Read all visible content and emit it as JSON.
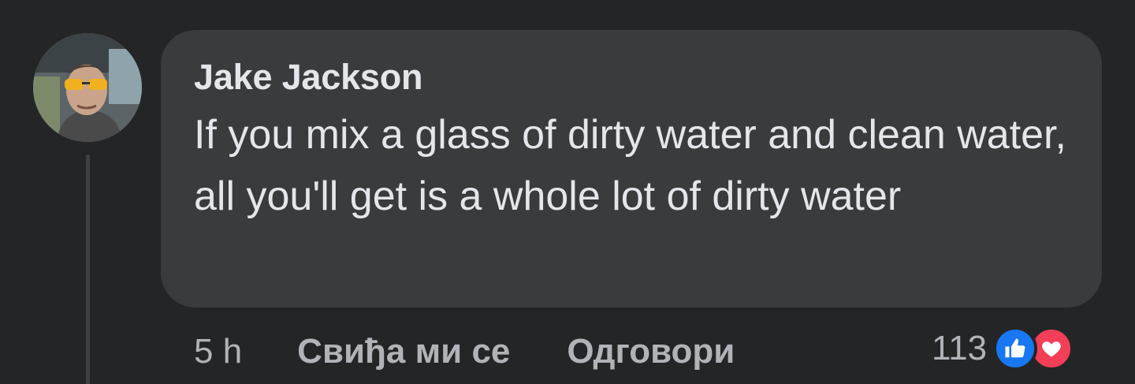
{
  "comment": {
    "author": "Jake Jackson",
    "text": "If you mix a glass of dirty water and clean water, all you'll get is a whole lot of dirty water",
    "avatar_icon": "user-avatar-photo"
  },
  "actions": {
    "time": "5 h",
    "like_label": "Свиђа ми се",
    "reply_label": "Одговори"
  },
  "reactions": {
    "count": "113",
    "icons": [
      "like-reaction-icon",
      "love-reaction-icon"
    ],
    "like_color": "#1877f2",
    "love_color": "#f33e58"
  },
  "colors": {
    "background": "#242526",
    "bubble": "#3a3b3c",
    "primary_text": "#e4e6eb",
    "secondary_text": "#b0b3b8"
  }
}
